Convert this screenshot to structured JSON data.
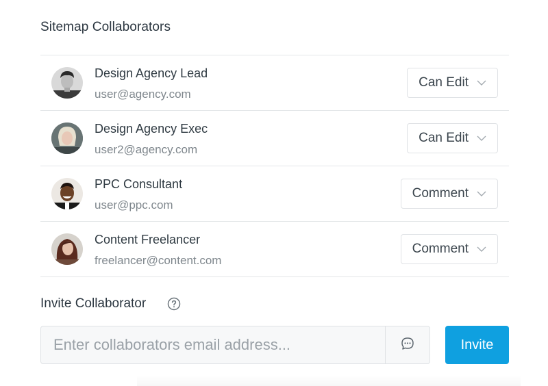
{
  "title": "Sitemap Collaborators",
  "collaborators": [
    {
      "name": "Design Agency Lead",
      "email": "user@agency.com",
      "permission": "Can Edit",
      "avatar": "avatar-man-dark-hair"
    },
    {
      "name": "Design Agency Exec",
      "email": "user2@agency.com",
      "permission": "Can Edit",
      "avatar": "avatar-woman-blonde"
    },
    {
      "name": "PPC Consultant",
      "email": "user@ppc.com",
      "permission": "Comment",
      "avatar": "avatar-man-smiling"
    },
    {
      "name": "Content Freelancer",
      "email": "freelancer@content.com",
      "permission": "Comment",
      "avatar": "avatar-woman-brunette"
    }
  ],
  "invite": {
    "title": "Invite Collaborator",
    "placeholder": "Enter collaborators email address...",
    "value": "",
    "button_label": "Invite",
    "help_icon": "question-circle-icon",
    "message_icon": "chat-bubble-icon"
  },
  "colors": {
    "accent": "#0fa0e0",
    "text": "#2f3a42",
    "muted": "#7f878d",
    "border": "#e3e6e8"
  }
}
